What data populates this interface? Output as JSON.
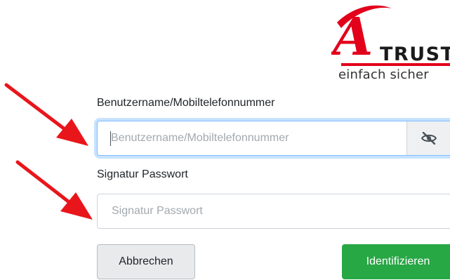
{
  "logo": {
    "brand_text": "TRUST",
    "mark_letter": "A",
    "tagline": "einfach sicher"
  },
  "form": {
    "username": {
      "label": "Benutzername/Mobiltelefonnummer",
      "placeholder": "Benutzername/Mobiltelefonnummer",
      "value": "",
      "toggle_icon": "eye-slash-icon"
    },
    "password": {
      "label": "Signatur Passwort",
      "placeholder": "Signatur Passwort",
      "value": ""
    }
  },
  "actions": {
    "cancel_label": "Abbrechen",
    "identify_label": "Identifizieren"
  },
  "annotations": {
    "arrow_icon": "red-arrow-icon",
    "arrow_color": "#e8161b"
  },
  "colors": {
    "brand_red": "#e2001a",
    "primary_green": "#28a745",
    "focus_blue": "#80bdff"
  }
}
